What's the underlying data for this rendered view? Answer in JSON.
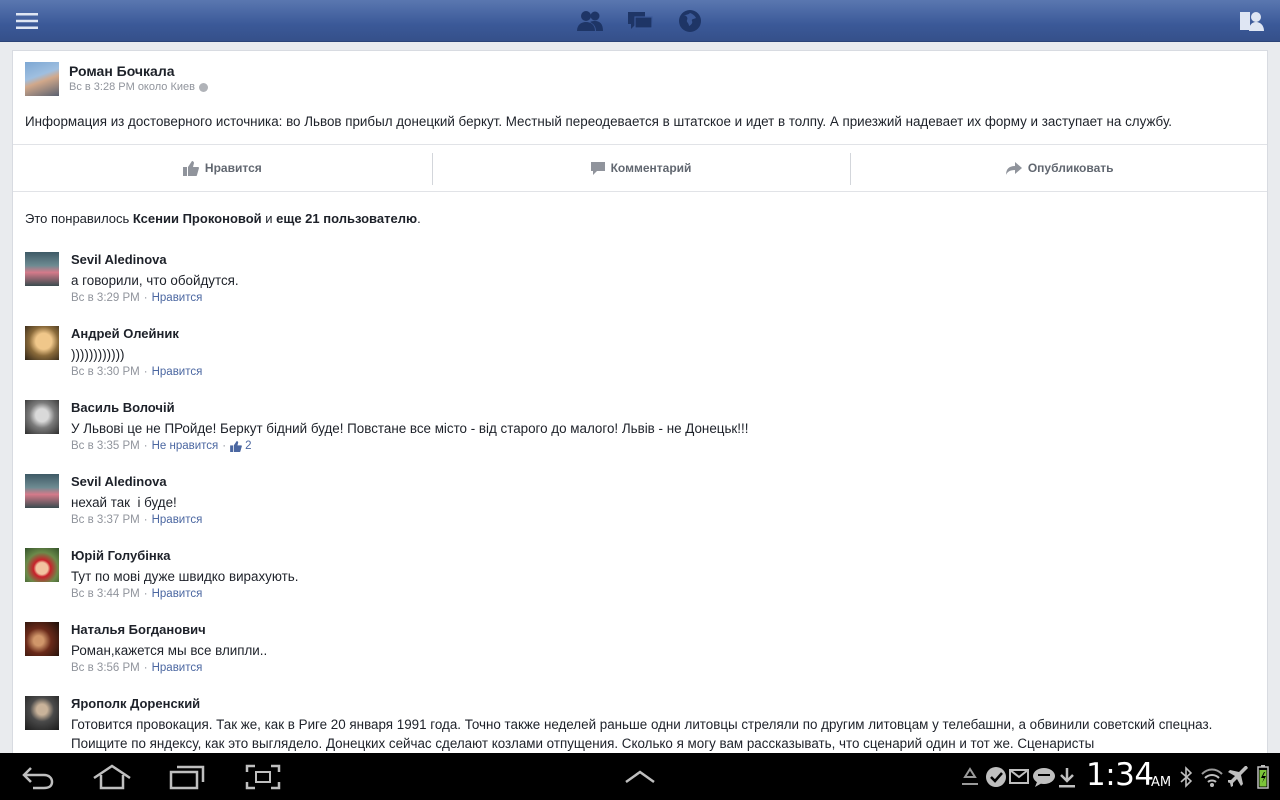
{
  "colors": {
    "brand": "#3b5998",
    "link": "#4b67a1",
    "meta": "#90949c"
  },
  "topbar": {
    "icons": [
      "menu-icon",
      "friend-requests-icon",
      "messages-icon",
      "notifications-globe-icon",
      "friends-list-icon"
    ]
  },
  "post": {
    "author": "Роман Бочкала",
    "meta": "Вс в 3:28 PM около Киев",
    "text": "Информация из достоверного источника: во Львов прибыл донецкий беркут. Местный переодевается в штатское и идет в толпу. А приезжий надевает их форму и заступает на службу.",
    "actions": {
      "like": "Нравится",
      "comment": "Комментарий",
      "share": "Опубликовать"
    }
  },
  "likes_summary": {
    "prefix": "Это понравилось ",
    "name": "Ксении Проконовой",
    "middle": " и ",
    "others": "еще 21 пользователю",
    "suffix": "."
  },
  "comments": [
    {
      "name": "Sevil Aledinova",
      "text": "а говорили, что обойдутся.",
      "time": "Вс в 3:29 PM",
      "like": "Нравится"
    },
    {
      "name": "Андрей Олейник",
      "text": "))))))))))))",
      "time": "Вс в 3:30 PM",
      "like": "Нравится"
    },
    {
      "name": "Василь Волочій",
      "text": "У Львові це не ПРойде! Беркут бідний буде! Повстане все місто - від старого до малого! Львів - не Донецьк!!!",
      "time": "Вс в 3:35 PM",
      "like": "Не нравится",
      "likes_count": "2"
    },
    {
      "name": "Sevil Aledinova",
      "text": "нехай так  і буде!",
      "time": "Вс в 3:37 PM",
      "like": "Нравится"
    },
    {
      "name": "Юрій Голубінка",
      "text": "Тут по мові дуже швидко вирахують.",
      "time": "Вс в 3:44 PM",
      "like": "Нравится"
    },
    {
      "name": "Наталья Богданович",
      "text": "Роман,кажется мы все влипли..",
      "time": "Вс в 3:56 PM",
      "like": "Нравится"
    },
    {
      "name": "Ярополк Доренский",
      "text": "Готовится провокация. Так же, как в Риге 20 января 1991 года. Точно также неделей раньше одни литовцы стреляли по другим литовцам у телебашни, а обвинили советский спецназ. Поищите по яндексу, как это выглядело. Донецких сейчас сделают козлами отпущения. Сколько я могу вам рассказывать, что сценарий один и тот же. Сценаристы"
    }
  ],
  "statusbar": {
    "time": "1:34",
    "ampm": "AM",
    "nav_icons": [
      "back-icon",
      "home-icon",
      "recent-apps-icon",
      "screenshot-icon",
      "expand-up-icon"
    ],
    "status_icons": [
      "recycle-icon",
      "check-badge-icon",
      "email-icon",
      "chat-bubble-icon",
      "download-icon",
      "bluetooth-icon",
      "wifi-icon",
      "airplane-icon",
      "battery-icon"
    ]
  }
}
